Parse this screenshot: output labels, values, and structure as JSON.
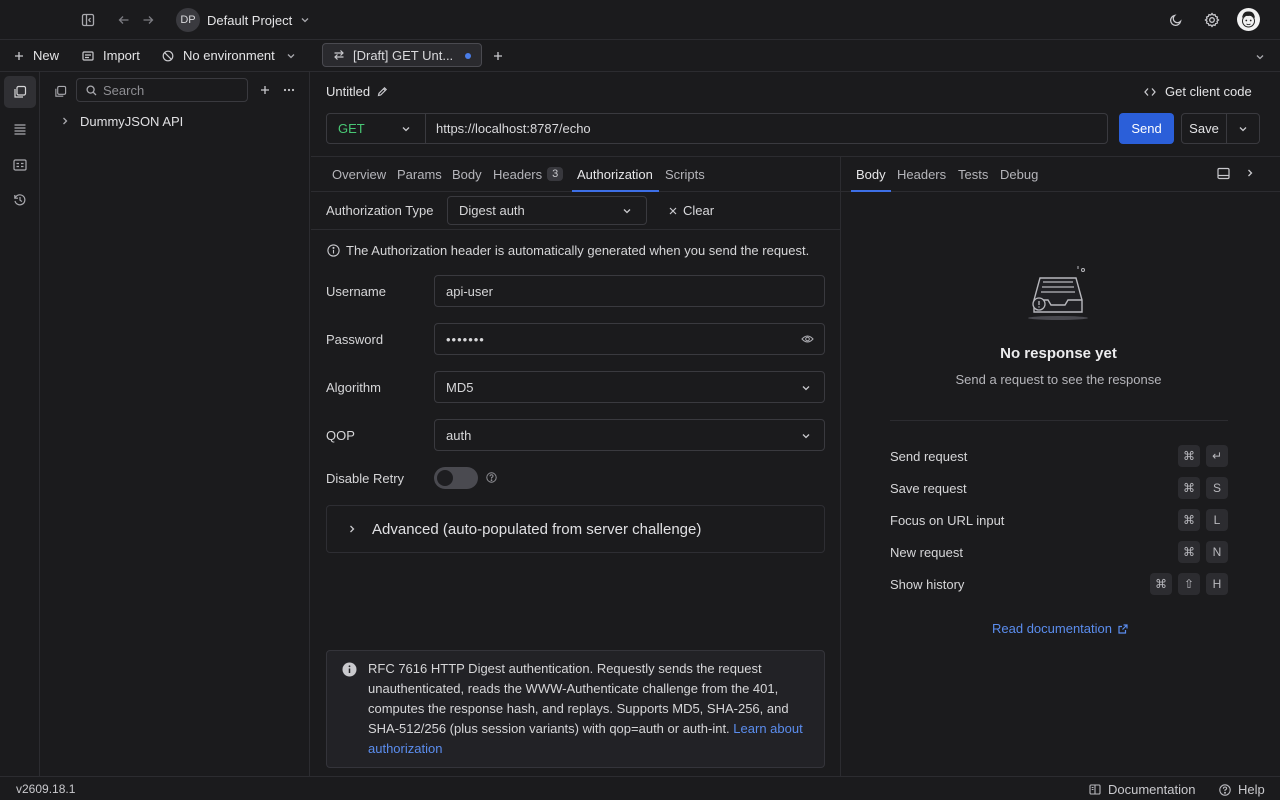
{
  "header": {
    "project_initials": "DP",
    "project_name": "Default Project"
  },
  "toolbar": {
    "new_label": "New",
    "import_label": "Import",
    "environment_label": "No environment"
  },
  "tabs": [
    {
      "label": "[Draft] GET Unt...",
      "modified": true
    }
  ],
  "sidebar": {
    "search_placeholder": "Search",
    "collections": [
      {
        "label": "DummyJSON API"
      }
    ]
  },
  "request": {
    "name": "Untitled",
    "get_client_code_label": "Get client code",
    "method": "GET",
    "url": "https://localhost:8787/echo",
    "send_label": "Send",
    "save_label": "Save",
    "tabs": {
      "overview": "Overview",
      "params": "Params",
      "body": "Body",
      "headers": "Headers",
      "headers_count": "3",
      "authorization": "Authorization",
      "scripts": "Scripts"
    },
    "active_tab": "Authorization"
  },
  "auth": {
    "type_label": "Authorization Type",
    "type_value": "Digest auth",
    "clear_label": "Clear",
    "info_text": "The Authorization header is automatically generated when you send the request.",
    "username_label": "Username",
    "username_value": "api-user",
    "password_label": "Password",
    "password_value": "•••••••",
    "algorithm_label": "Algorithm",
    "algorithm_value": "MD5",
    "qop_label": "QOP",
    "qop_value": "auth",
    "disable_retry_label": "Disable Retry",
    "disable_retry_on": false,
    "advanced_label": "Advanced (auto-populated from server challenge)",
    "note_text": "RFC 7616 HTTP Digest authentication. Requestly sends the request unauthenticated, reads the WWW-Authenticate challenge from the 401, computes the response hash, and replays. Supports MD5, SHA-256, and SHA-512/256 (plus session variants) with qop=auth or auth-int.",
    "note_link": "Learn about authorization"
  },
  "response": {
    "tabs": [
      "Body",
      "Headers",
      "Tests",
      "Debug"
    ],
    "active_tab": "Body",
    "empty_title": "No response yet",
    "empty_subtitle": "Send a request to see the response",
    "shortcuts": [
      {
        "label": "Send request",
        "keys": [
          "⌘",
          "↵"
        ]
      },
      {
        "label": "Save request",
        "keys": [
          "⌘",
          "S"
        ]
      },
      {
        "label": "Focus on URL input",
        "keys": [
          "⌘",
          "L"
        ]
      },
      {
        "label": "New request",
        "keys": [
          "⌘",
          "N"
        ]
      },
      {
        "label": "Show history",
        "keys": [
          "⌘",
          "⇧",
          "H"
        ]
      }
    ],
    "docs_link": "Read documentation"
  },
  "status": {
    "version": "v2609.18.1",
    "documentation_label": "Documentation",
    "help_label": "Help"
  },
  "colors": {
    "accent": "#2b5fd9",
    "link": "#5b8dee",
    "background": "#1b1b1d"
  }
}
